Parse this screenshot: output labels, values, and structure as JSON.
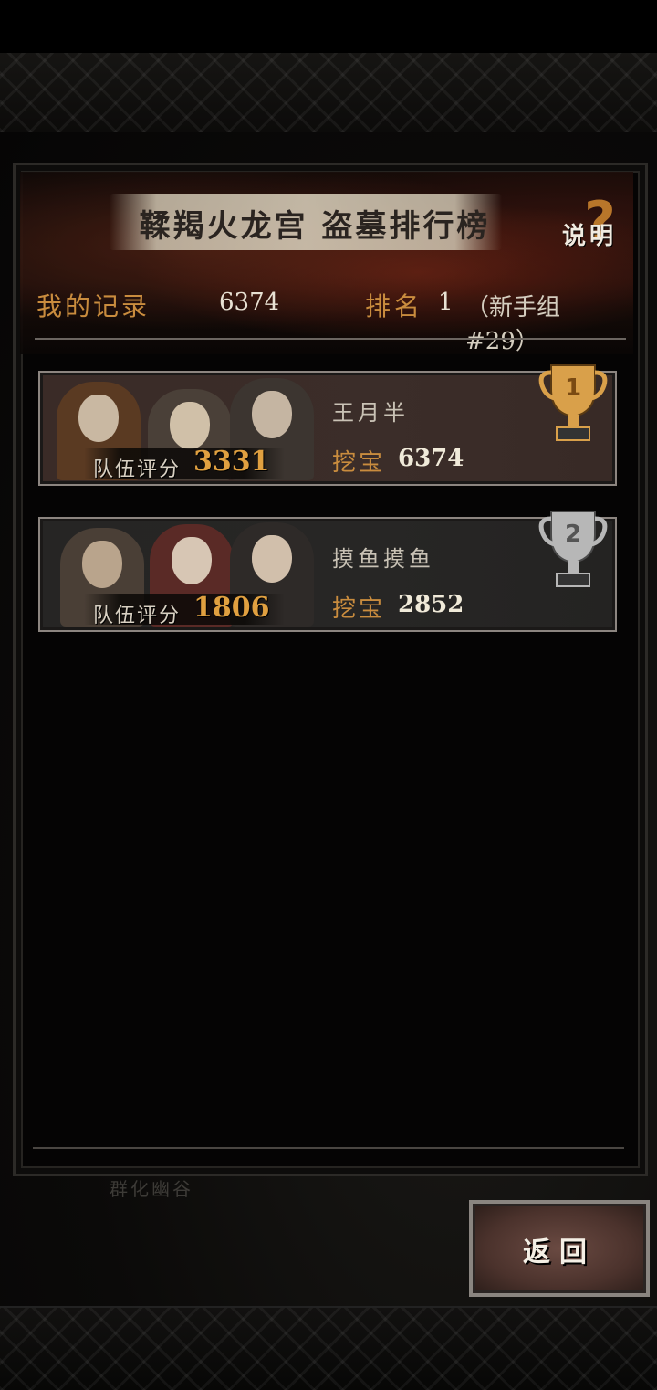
{
  "map": {
    "area_label": "群化幽谷"
  },
  "leaderboard": {
    "title": "鞣羯火龙宫 盗墓排行榜",
    "help_label": "说明",
    "help_icon": "question-mark-icon",
    "my_record": {
      "label": "我的记录",
      "value": "6374",
      "rank_label": "排名",
      "rank_value": "1",
      "group": "（新手组#29）"
    },
    "entries": [
      {
        "rank": "1",
        "trophy_icon": "gold-trophy-icon",
        "trophy_color": "#d9a04a",
        "name": "王月半",
        "team_score_label": "队伍评分",
        "team_score": "3331",
        "dig_label": "挖宝",
        "dig_value": "6374"
      },
      {
        "rank": "2",
        "trophy_icon": "silver-trophy-icon",
        "trophy_color": "#b7b7b7",
        "name": "摸鱼摸鱼",
        "team_score_label": "队伍评分",
        "team_score": "1806",
        "dig_label": "挖宝",
        "dig_value": "2852"
      }
    ]
  },
  "back_button": {
    "label": "返回"
  },
  "colors": {
    "accent_orange": "#c98c3e",
    "score_gold": "#e0a040",
    "card1_bg": "#3a2b27",
    "card2_bg": "#262524"
  }
}
